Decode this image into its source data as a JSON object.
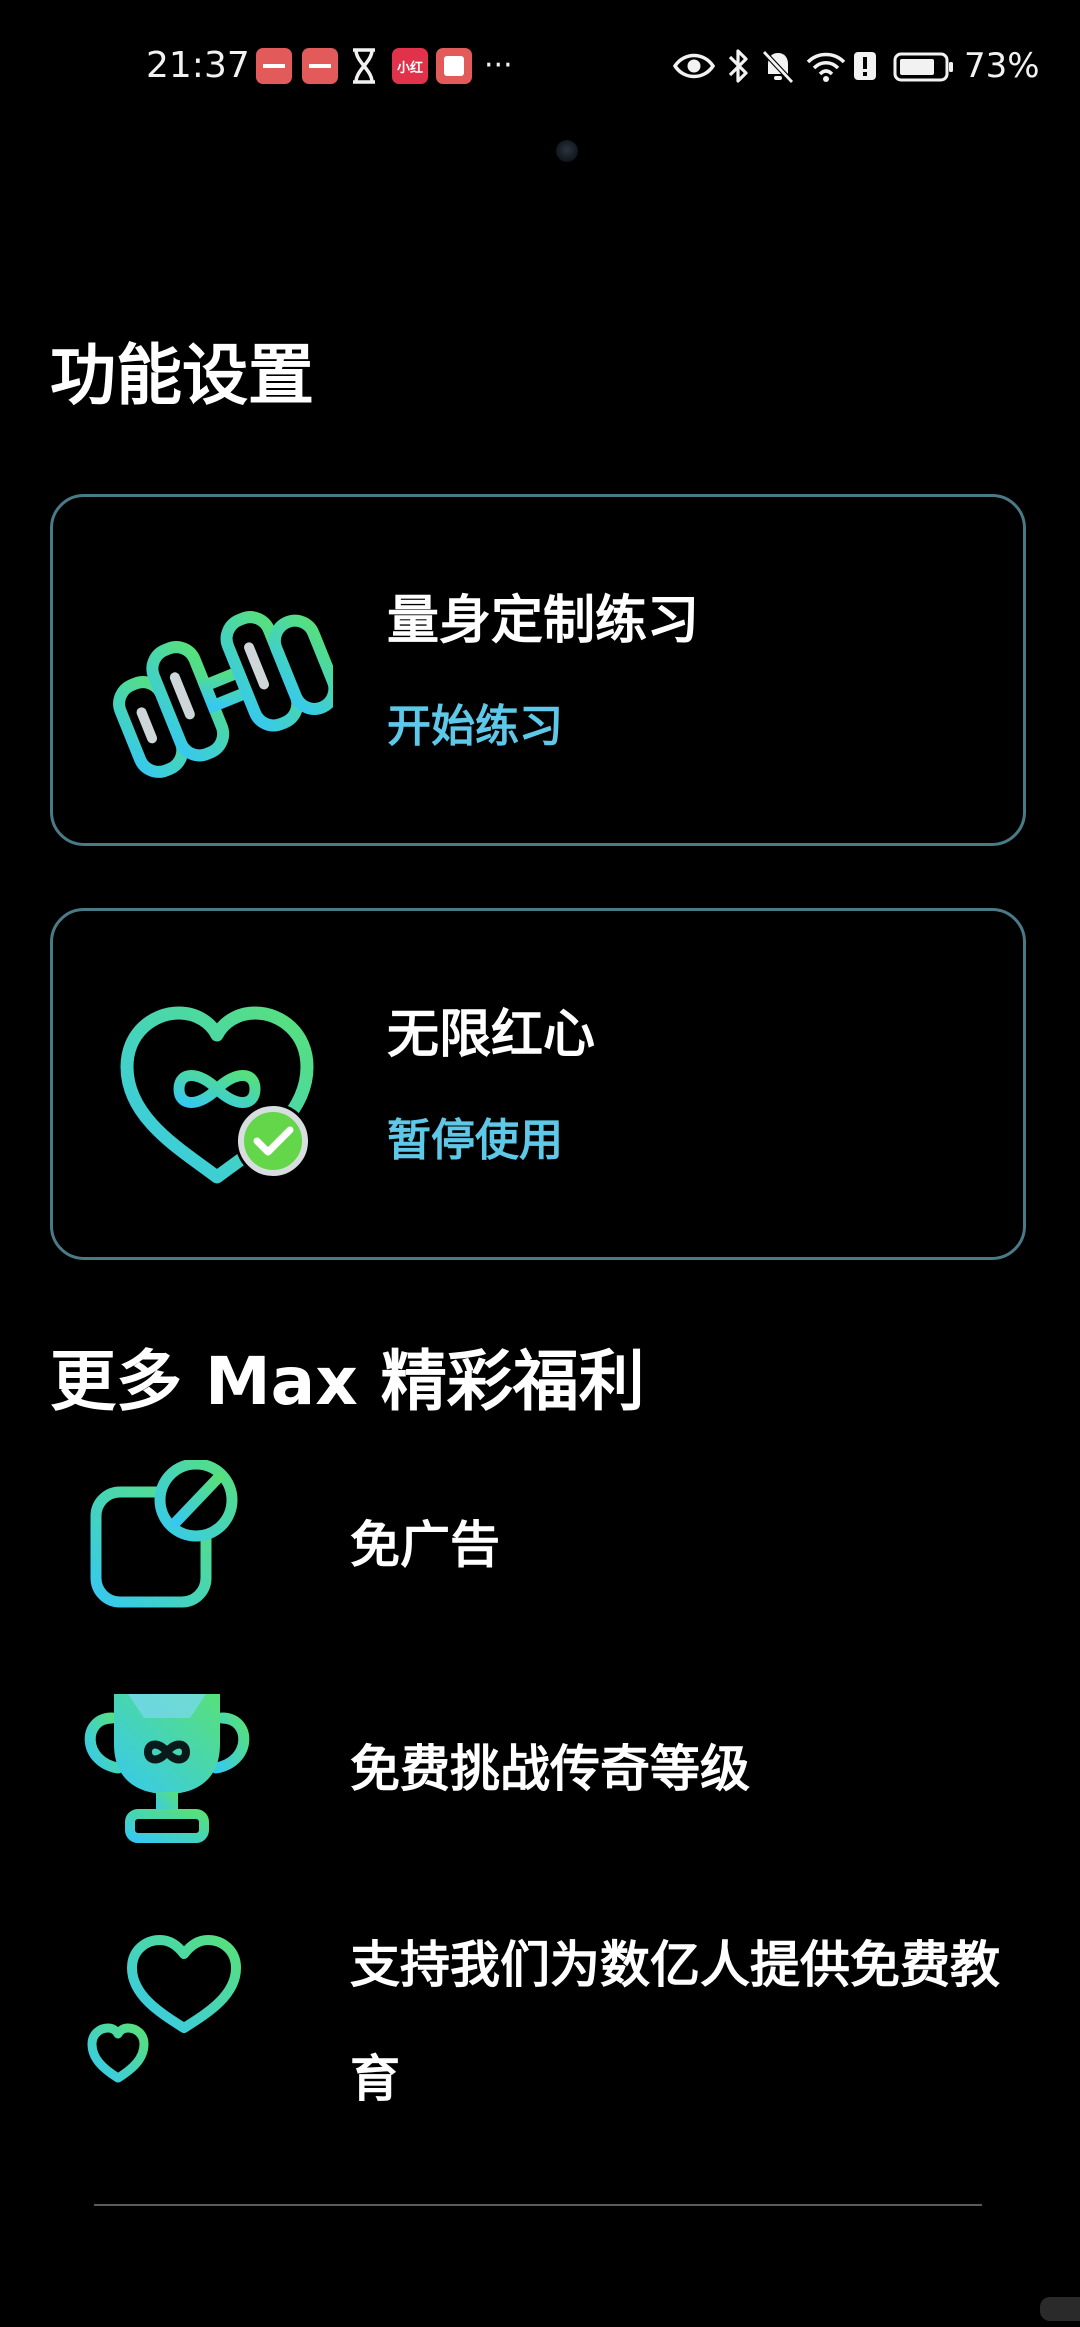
{
  "status_bar": {
    "time": "21:37",
    "more_indicator": "···",
    "battery_percent": "73%",
    "notification_icons": [
      "red-app-icon",
      "red-app-icon",
      "hourglass-icon",
      "red-app-icon",
      "red-app-icon"
    ],
    "system_icons": [
      "eye-icon",
      "bluetooth-icon",
      "bell-muted-icon",
      "wifi-icon",
      "battery-icon"
    ]
  },
  "features": {
    "title": "功能设置",
    "cards": [
      {
        "title": "量身定制练习",
        "action": "开始练习",
        "icon": "dumbbell-icon"
      },
      {
        "title": "无限红心",
        "action": "暂停使用",
        "icon": "infinity-heart-check-icon"
      }
    ]
  },
  "benefits": {
    "title": "更多 Max 精彩福利",
    "items": [
      {
        "text": "免广告",
        "icon": "no-ads-icon"
      },
      {
        "text": "免费挑战传奇等级",
        "icon": "trophy-icon"
      },
      {
        "text": "支持我们为数亿人提供免费教育",
        "icon": "hearts-icon"
      }
    ]
  },
  "colors": {
    "background": "#000000",
    "card_border": "#4a7a86",
    "accent_text": "#5ec8e8",
    "gradient_start": "#36c9f0",
    "gradient_end": "#58e07a"
  }
}
